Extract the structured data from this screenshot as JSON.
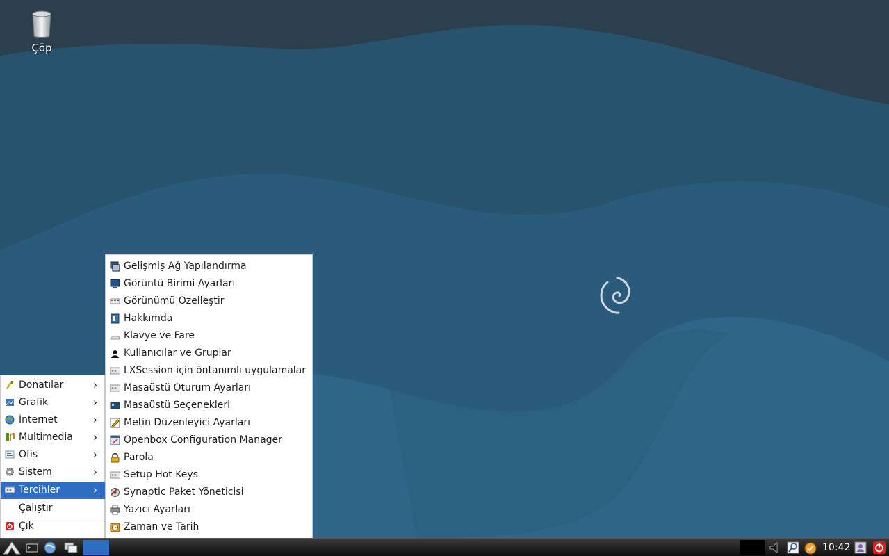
{
  "desktop": {
    "icons": [
      {
        "label": "Çöp",
        "icon": "trash-icon"
      }
    ]
  },
  "start_menu": {
    "items": [
      {
        "label": "Donatılar",
        "icon": "accessories-icon",
        "submenu": true
      },
      {
        "label": "Grafik",
        "icon": "graphics-icon",
        "submenu": true
      },
      {
        "label": "İnternet",
        "icon": "internet-globe-icon",
        "submenu": true
      },
      {
        "label": "Multimedia",
        "icon": "multimedia-icon",
        "submenu": true
      },
      {
        "label": "Ofis",
        "icon": "office-icon",
        "submenu": true
      },
      {
        "label": "Sistem",
        "icon": "system-gear-icon",
        "submenu": true
      },
      {
        "label": "Tercihler",
        "icon": "preferences-icon",
        "submenu": true,
        "active": true
      }
    ],
    "run_label": "Çalıştır",
    "logout_label": "Çık",
    "arrow_glyph": "›"
  },
  "preferences_submenu": {
    "items": [
      {
        "label": "Gelişmiş Ağ Yapılandırma",
        "icon": "network-config-icon"
      },
      {
        "label": "Görüntü Birimi Ayarları",
        "icon": "monitor-icon"
      },
      {
        "label": "Görünümü Özelleştir",
        "icon": "appearance-icon"
      },
      {
        "label": "Hakkımda",
        "icon": "about-me-icon"
      },
      {
        "label": "Klavye ve Fare",
        "icon": "keyboard-mouse-icon"
      },
      {
        "label": "Kullanıcılar ve Gruplar",
        "icon": "users-groups-icon"
      },
      {
        "label": "LXSession için öntanımlı uygulamalar",
        "icon": "lxsession-defaults-icon"
      },
      {
        "label": "Masaüstü Oturum Ayarları",
        "icon": "session-settings-icon"
      },
      {
        "label": "Masaüstü Seçenekleri",
        "icon": "desktop-options-icon"
      },
      {
        "label": "Metin Düzenleyici Ayarları",
        "icon": "text-editor-icon"
      },
      {
        "label": "Openbox Configuration Manager",
        "icon": "openbox-icon"
      },
      {
        "label": "Parola",
        "icon": "lock-icon"
      },
      {
        "label": "Setup Hot Keys",
        "icon": "hotkeys-icon"
      },
      {
        "label": "Synaptic Paket Yöneticisi",
        "icon": "synaptic-icon"
      },
      {
        "label": "Yazıcı Ayarları",
        "icon": "printer-icon"
      },
      {
        "label": "Zaman ve Tarih",
        "icon": "clock-date-icon"
      }
    ]
  },
  "taskbar": {
    "clock": "10:42",
    "launchers": [
      "menu-logo-icon",
      "terminal-icon",
      "browser-icon",
      "window-switch-icon"
    ],
    "tray": [
      "volume-icon",
      "search-tray-icon",
      "update-notifier-icon",
      "user-switch-icon",
      "power-icon"
    ]
  },
  "colors": {
    "accent": "#2d6ec4",
    "wallpaper": "#1f4a66",
    "power": "#d81e1e"
  }
}
